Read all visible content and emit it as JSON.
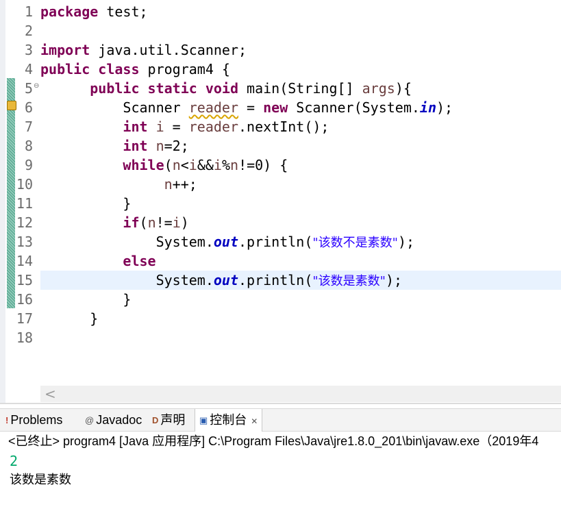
{
  "editor": {
    "line_numbers": [
      "1",
      "2",
      "3",
      "4",
      "5",
      "6",
      "7",
      "8",
      "9",
      "10",
      "11",
      "12",
      "13",
      "14",
      "15",
      "16",
      "17",
      "18"
    ],
    "fold_marker": "⊖",
    "code": {
      "l1_kw": "package",
      "l1_rest": " test;",
      "l3_kw": "import",
      "l3_rest": " java.util.Scanner;",
      "l4_kw1": "public",
      "l4_kw2": "class",
      "l4_rest": " program4 {",
      "l5_indent": "      ",
      "l5_kw1": "public",
      "l5_kw2": "static",
      "l5_kw3": "void",
      "l5_a": " main(String[] ",
      "l5_var": "args",
      "l5_b": "){",
      "l6_indent": "          ",
      "l6_a": "Scanner ",
      "l6_var": "reader",
      "l6_b": " = ",
      "l6_kw": "new",
      "l6_c": " Scanner(System.",
      "l6_fld": "in",
      "l6_d": ");",
      "l7_indent": "          ",
      "l7_kw": "int",
      "l7_a": " ",
      "l7_var1": "i",
      "l7_b": " = ",
      "l7_var2": "reader",
      "l7_c": ".nextInt();",
      "l8_indent": "          ",
      "l8_kw": "int",
      "l8_a": " ",
      "l8_var": "n",
      "l8_b": "=2;",
      "l9_indent": "          ",
      "l9_kw": "while",
      "l9_a": "(",
      "l9_v1": "n",
      "l9_b": "<",
      "l9_v2": "i",
      "l9_c": "&&",
      "l9_v3": "i",
      "l9_d": "%",
      "l9_v4": "n",
      "l9_e": "!=0) {",
      "l10_indent": "               ",
      "l10_var": "n",
      "l10_a": "++;",
      "l11_indent": "          ",
      "l11_a": "}",
      "l12_indent": "          ",
      "l12_kw": "if",
      "l12_a": "(",
      "l12_v1": "n",
      "l12_b": "!=",
      "l12_v2": "i",
      "l12_c": ")",
      "l13_indent": "              ",
      "l13_a": "System.",
      "l13_fld": "out",
      "l13_b": ".println(",
      "l13_str": "\"该数不是素数\"",
      "l13_c": ");",
      "l14_indent": "          ",
      "l14_kw": "else",
      "l15_indent": "              ",
      "l15_a": "System.",
      "l15_fld": "out",
      "l15_b": ".println(",
      "l15_str": "\"该数是素数\"",
      "l15_c": ");",
      "l16_indent": "          ",
      "l16_a": "}",
      "l17_indent": "      ",
      "l17_a": "}"
    },
    "scroll_left_glyph": "<"
  },
  "views": {
    "tabs": [
      {
        "icon": "!",
        "label": "Problems"
      },
      {
        "icon": "@",
        "label": "Javadoc"
      },
      {
        "icon": "D",
        "label": "声明"
      },
      {
        "icon": "▣",
        "label": "控制台",
        "close": "✕"
      }
    ],
    "console": {
      "status": "<已终止> program4 [Java 应用程序] C:\\Program Files\\Java\\jre1.8.0_201\\bin\\javaw.exe（2019年4",
      "input": "2",
      "output": "该数是素数"
    }
  },
  "colors": {
    "keyword": "#7f0055",
    "string": "#2a00ff",
    "static_field": "#0000c0",
    "local_variable": "#6a3e3e",
    "console_input": "#00a86b",
    "current_line": "#e8f2fe"
  }
}
